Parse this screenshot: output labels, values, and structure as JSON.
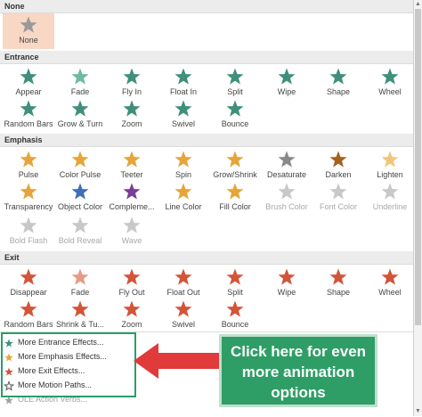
{
  "sections": [
    {
      "title": "None",
      "items": [
        {
          "label": "None",
          "icon": "star-none-icon",
          "color": "#9a9a9a",
          "selected": true
        }
      ]
    },
    {
      "title": "Entrance",
      "items": [
        {
          "label": "Appear",
          "icon": "star-burst-icon",
          "color": "#3f8f7b"
        },
        {
          "label": "Fade",
          "icon": "star-faded-icon",
          "color": "#6fb8a4"
        },
        {
          "label": "Fly In",
          "icon": "star-arrow-icon",
          "color": "#3f8f7b"
        },
        {
          "label": "Float In",
          "icon": "star-arrow-icon",
          "color": "#3f8f7b"
        },
        {
          "label": "Split",
          "icon": "star-split-icon",
          "color": "#3f8f7b"
        },
        {
          "label": "Wipe",
          "icon": "star-half-icon",
          "color": "#3f8f7b"
        },
        {
          "label": "Shape",
          "icon": "star-shape-icon",
          "color": "#3f8f7b"
        },
        {
          "label": "Wheel",
          "icon": "star-wheel-icon",
          "color": "#3f8f7b"
        },
        {
          "label": "Random Bars",
          "icon": "star-bars-icon",
          "color": "#3f8f7b"
        },
        {
          "label": "Grow & Turn",
          "icon": "star-tilted-icon",
          "color": "#3f8f7b"
        },
        {
          "label": "Zoom",
          "icon": "star-zoom-icon",
          "color": "#3f8f7b"
        },
        {
          "label": "Swivel",
          "icon": "star-swivel-icon",
          "color": "#3f8f7b"
        },
        {
          "label": "Bounce",
          "icon": "star-bounce-icon",
          "color": "#3f8f7b"
        }
      ]
    },
    {
      "title": "Emphasis",
      "items": [
        {
          "label": "Pulse",
          "icon": "star-pulse-icon",
          "color": "#e5a53a"
        },
        {
          "label": "Color Pulse",
          "icon": "star-color-pulse-icon",
          "color": "#e5a53a"
        },
        {
          "label": "Teeter",
          "icon": "star-teeter-icon",
          "color": "#e5a53a"
        },
        {
          "label": "Spin",
          "icon": "star-spin-icon",
          "color": "#e5a53a"
        },
        {
          "label": "Grow/Shrink",
          "icon": "star-grow-icon",
          "color": "#e5a53a"
        },
        {
          "label": "Desaturate",
          "icon": "star-desaturate-icon",
          "color": "#8a8a8a"
        },
        {
          "label": "Darken",
          "icon": "star-darken-icon",
          "color": "#a5621e"
        },
        {
          "label": "Lighten",
          "icon": "star-lighten-icon",
          "color": "#f2c67a"
        },
        {
          "label": "Transparency",
          "icon": "star-transparency-icon",
          "color": "#e5a53a"
        },
        {
          "label": "Object Color",
          "icon": "star-object-color-icon",
          "color": "#3d6fb8"
        },
        {
          "label": "Compleme...",
          "icon": "star-complement-icon",
          "color": "#7a3d9a"
        },
        {
          "label": "Line Color",
          "icon": "star-line-color-icon",
          "color": "#e5a53a"
        },
        {
          "label": "Fill Color",
          "icon": "star-fill-color-icon",
          "color": "#e5a53a"
        },
        {
          "label": "Brush Color",
          "icon": "star-brush-color-icon",
          "color": "#c8c8c8",
          "disabled": true
        },
        {
          "label": "Font Color",
          "icon": "star-font-color-icon",
          "color": "#c8c8c8",
          "disabled": true
        },
        {
          "label": "Underline",
          "icon": "star-underline-icon",
          "color": "#c8c8c8",
          "disabled": true
        },
        {
          "label": "Bold Flash",
          "icon": "star-bold-flash-icon",
          "color": "#c8c8c8",
          "disabled": true
        },
        {
          "label": "Bold Reveal",
          "icon": "star-bold-reveal-icon",
          "color": "#c8c8c8",
          "disabled": true
        },
        {
          "label": "Wave",
          "icon": "star-wave-icon",
          "color": "#c8c8c8",
          "disabled": true
        }
      ]
    },
    {
      "title": "Exit",
      "items": [
        {
          "label": "Disappear",
          "icon": "star-burst-icon",
          "color": "#d2553a"
        },
        {
          "label": "Fade",
          "icon": "star-faded-icon",
          "color": "#e79a86"
        },
        {
          "label": "Fly Out",
          "icon": "star-arrow-icon",
          "color": "#d2553a"
        },
        {
          "label": "Float Out",
          "icon": "star-arrow-icon",
          "color": "#d2553a"
        },
        {
          "label": "Split",
          "icon": "star-split-icon",
          "color": "#d2553a"
        },
        {
          "label": "Wipe",
          "icon": "star-half-icon",
          "color": "#d2553a"
        },
        {
          "label": "Shape",
          "icon": "star-shape-icon",
          "color": "#d2553a"
        },
        {
          "label": "Wheel",
          "icon": "star-wheel-icon",
          "color": "#d2553a"
        },
        {
          "label": "Random Bars",
          "icon": "star-bars-icon",
          "color": "#d2553a"
        },
        {
          "label": "Shrink & Tu...",
          "icon": "star-tilted-icon",
          "color": "#d2553a"
        },
        {
          "label": "Zoom",
          "icon": "star-zoom-icon",
          "color": "#d2553a"
        },
        {
          "label": "Swivel",
          "icon": "star-swivel-icon",
          "color": "#d2553a"
        },
        {
          "label": "Bounce",
          "icon": "star-bounce-icon",
          "color": "#d2553a"
        }
      ]
    }
  ],
  "more_effects": [
    {
      "label": "More Entrance Effects...",
      "icon": "entrance-star-icon",
      "color": "#3f8f7b"
    },
    {
      "label": "More Emphasis Effects...",
      "icon": "emphasis-star-icon",
      "color": "#e5a53a"
    },
    {
      "label": "More Exit Effects...",
      "icon": "exit-star-icon",
      "color": "#d2553a"
    },
    {
      "label": "More Motion Paths...",
      "icon": "motion-path-star-icon",
      "color": "#555555"
    },
    {
      "label": "OLE Action Verbs...",
      "icon": "ole-gear-icon",
      "color": "#a0a0a0",
      "disabled": true
    }
  ],
  "callout": {
    "text": "Click here for even more animation options",
    "color": "#2e9e66",
    "arrow_color": "#e03a3a"
  },
  "accent": {
    "selected_bg": "#f8d7c4",
    "highlight_border": "#2a9d6b"
  }
}
